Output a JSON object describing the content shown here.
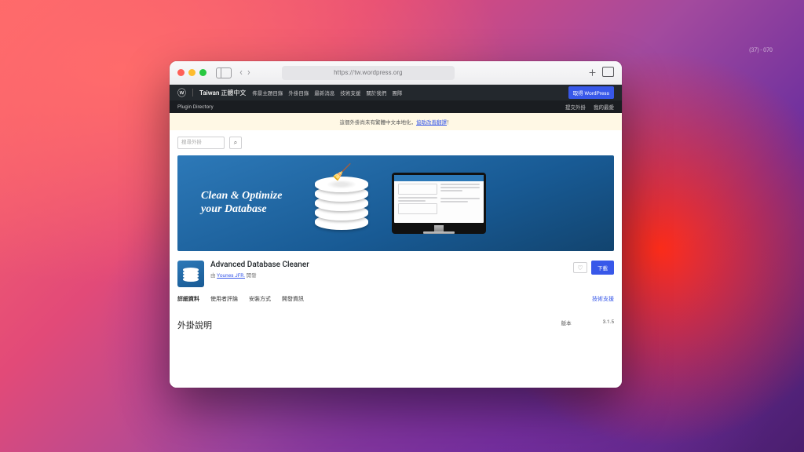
{
  "browser": {
    "url": "https://tw.wordpress.org",
    "zoom_indicator": "(37) - 070"
  },
  "wp_header": {
    "site_title": "Taiwan 正體中文",
    "menu": [
      "佈景主題目錄",
      "外掛目錄",
      "最新消息",
      "技術支援",
      "關於我們",
      "團隊"
    ],
    "get_button": "取得 WordPress"
  },
  "wp_subnav": {
    "left": "Plugin Directory",
    "right": [
      "提交外掛",
      "我的最愛"
    ]
  },
  "notice": {
    "text_before": "這個外掛尚未有繁體中文本地化，",
    "link": "協助改善翻譯",
    "text_after": "！"
  },
  "search": {
    "placeholder": "搜尋外掛"
  },
  "banner": {
    "headline_l1": "Clean & Optimize",
    "headline_l2": "your Database"
  },
  "plugin": {
    "title": "Advanced Database Cleaner",
    "by_prefix": "由 ",
    "author": "Younes JFR.",
    "by_suffix": " 開發",
    "download": "下載"
  },
  "tabs": {
    "items": [
      "詳細資料",
      "使用者評論",
      "安裝方式",
      "開發資訊"
    ],
    "support": "技術支援"
  },
  "content": {
    "description_heading": "外掛說明",
    "meta_label": "版本",
    "meta_value": "3.1.5"
  }
}
